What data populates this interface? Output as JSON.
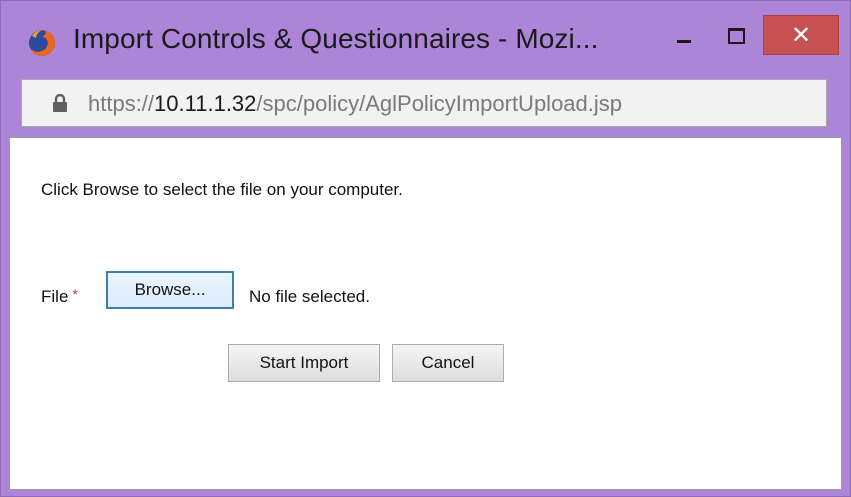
{
  "window": {
    "title": "Import Controls & Questionnaires - Mozi...",
    "close_label": "✕",
    "colors": {
      "frame": "#ac85d9",
      "close": "#c75050",
      "focus_border": "#3c7fb1"
    }
  },
  "addressbar": {
    "scheme": "https://",
    "host": "10.11.1.32",
    "path": "/spc/policy/AglPolicyImportUpload.jsp"
  },
  "form": {
    "instructions": "Click Browse to select the file on your computer.",
    "file_label": "File",
    "required_marker": "*",
    "browse_label": "Browse...",
    "no_file_text": "No file selected.",
    "start_import_label": "Start Import",
    "cancel_label": "Cancel"
  },
  "icons": {
    "app": "firefox-icon",
    "lock": "lock-icon",
    "minimize": "minimize-icon",
    "maximize": "maximize-icon",
    "close": "close-icon"
  }
}
